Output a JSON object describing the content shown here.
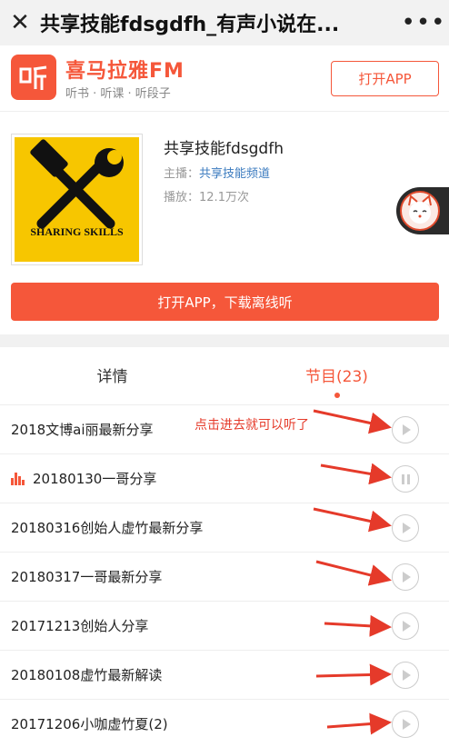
{
  "topbar": {
    "title": "共享技能fdsgdfh_有声小说在...",
    "close_icon": "close-icon",
    "more_icon": "more-icon"
  },
  "brand": {
    "logo_char": "听",
    "name": "喜马拉雅FM",
    "slogan": "听书 · 听课 · 听段子",
    "open_app_label": "打开APP",
    "accent": "#f5573a"
  },
  "album": {
    "title": "共享技能fdsgdfh",
    "cover_text": "SHARING SKILLS",
    "host_label": "主播：",
    "host_name": "共享技能频道",
    "plays_label": "播放：",
    "plays_value": "12.1万次",
    "download_label": "打开APP，下载离线听"
  },
  "tabs": {
    "details": "详情",
    "programs": "节目(23)"
  },
  "annotation": "点击进去就可以听了",
  "episodes": [
    {
      "title": "2018文博ai丽最新分享",
      "state": "play"
    },
    {
      "title": "20180130一哥分享",
      "state": "pause"
    },
    {
      "title": "20180316创始人虚竹最新分享",
      "state": "play"
    },
    {
      "title": "20180317一哥最新分享",
      "state": "play"
    },
    {
      "title": "20171213创始人分享",
      "state": "play"
    },
    {
      "title": "20180108虚竹最新解读",
      "state": "play"
    },
    {
      "title": "20171206小咖虚竹夏(2)",
      "state": "play"
    }
  ],
  "colors": {
    "accent": "#f5573a",
    "annotation": "#e53a2a",
    "link": "#3b7bbf"
  }
}
